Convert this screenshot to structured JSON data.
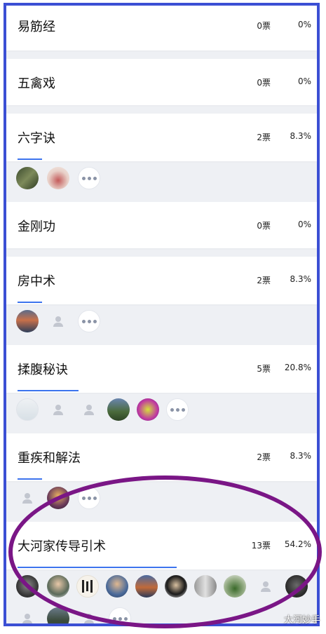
{
  "options": [
    {
      "label": "易筋经",
      "votes": "0票",
      "pct": "0%",
      "fraction": 0
    },
    {
      "label": "五禽戏",
      "votes": "0票",
      "pct": "0%",
      "fraction": 0
    },
    {
      "label": "六字诀",
      "votes": "2票",
      "pct": "8.3%",
      "fraction": 0.083
    },
    {
      "label": "金刚功",
      "votes": "0票",
      "pct": "0%",
      "fraction": 0
    },
    {
      "label": "房中术",
      "votes": "2票",
      "pct": "8.3%",
      "fraction": 0.083
    },
    {
      "label": "揉腹秘诀",
      "votes": "5票",
      "pct": "20.8%",
      "fraction": 0.208
    },
    {
      "label": "重疾和解法",
      "votes": "2票",
      "pct": "8.3%",
      "fraction": 0.083
    },
    {
      "label": "大河家传导引术",
      "votes": "13票",
      "pct": "54.2%",
      "fraction": 0.542
    }
  ],
  "colors": {
    "frame_border": "#3b4fd4",
    "progress_bar": "#3d74ee",
    "highlight_oval": "#7a1686",
    "list_background": "#eef0f4"
  },
  "icons": {
    "more": "more-dots-icon",
    "default_avatar": "person-silhouette-icon"
  },
  "watermark": "大河妙手"
}
